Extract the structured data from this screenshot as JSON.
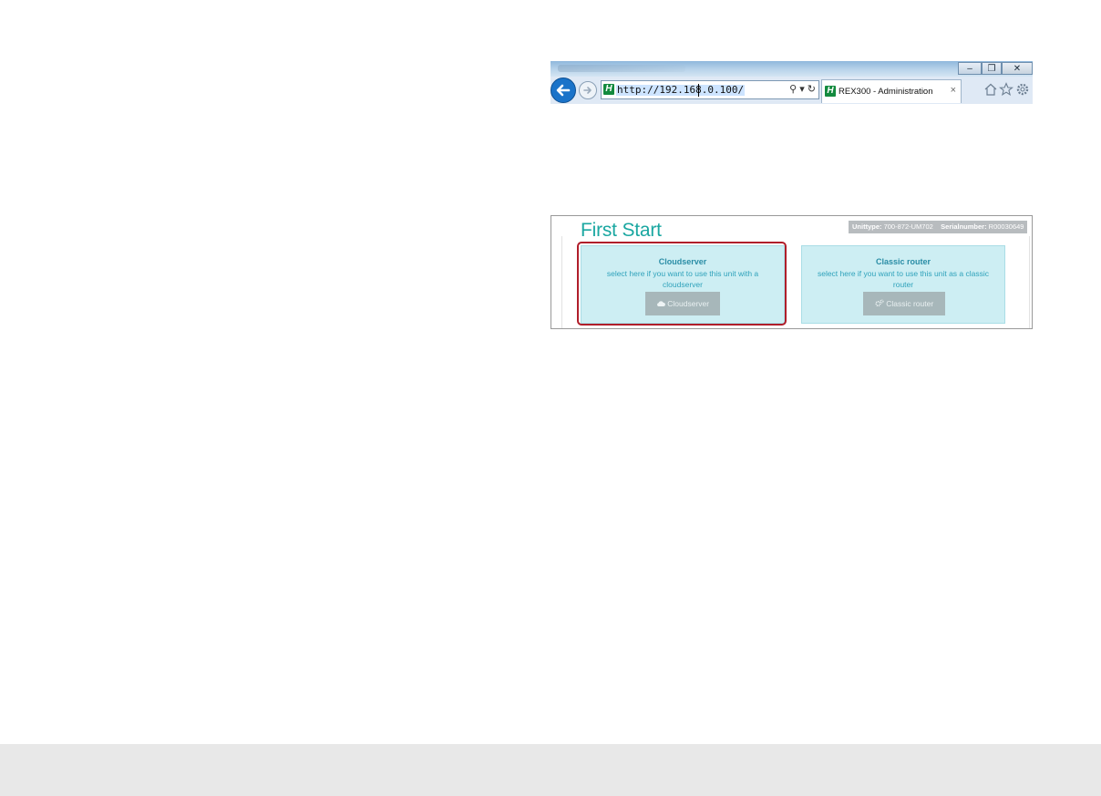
{
  "browser": {
    "url": "http://192.168.0.100/",
    "tab_title": "REX300 - Administration",
    "logo_letter": "H",
    "search_icons": "⚲ ▾ ↻",
    "window_buttons": {
      "minimize": "–",
      "restore": "❐",
      "close": "✕"
    },
    "tab_close": "×",
    "icons": [
      "back-arrow-icon",
      "forward-arrow-icon",
      "home-icon",
      "favorites-star-icon",
      "settings-gear-icon"
    ]
  },
  "page": {
    "title": "First Start",
    "unittype_label": "Unittype:",
    "unittype_value": "700-872-UM702",
    "serial_label": "Serialnumber:",
    "serial_value": "R00030649",
    "cards": [
      {
        "title": "Cloudserver",
        "description": "select here if you want to use this unit with a cloudserver",
        "button": "Cloudserver",
        "icon": "cloud-icon"
      },
      {
        "title": "Classic router",
        "description": "select here if you want to use this unit as a classic router",
        "button": "Classic router",
        "icon": "gears-icon"
      }
    ]
  },
  "colors": {
    "title_teal": "#1aa7a1",
    "card_bg": "#cdeef3",
    "button_gray": "#a7b7ba",
    "highlight_red": "#b01e2a"
  }
}
